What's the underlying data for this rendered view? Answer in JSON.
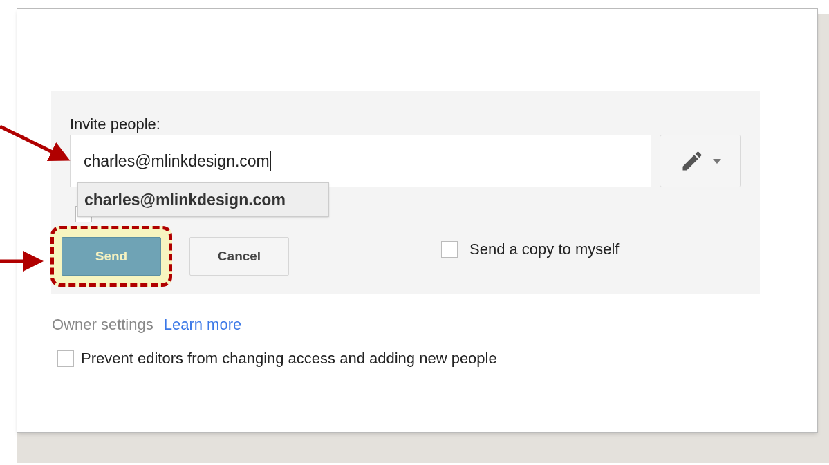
{
  "invite": {
    "label": "Invite people:",
    "value": "charles@mlinkdesign.com",
    "suggestion": "charles@mlinkdesign.com"
  },
  "notify_people": {
    "checked": false
  },
  "buttons": [
    {
      "label": "Send",
      "kind": "primary",
      "highlighted": true
    },
    {
      "label": "Cancel",
      "kind": "secondary",
      "highlighted": false
    }
  ],
  "send_copy": {
    "label": "Send a copy to myself",
    "checked": false
  },
  "owner_settings": {
    "label": "Owner settings",
    "link": "Learn more"
  },
  "prevent_editors": {
    "label": "Prevent editors from changing access and adding new people",
    "checked": false
  }
}
